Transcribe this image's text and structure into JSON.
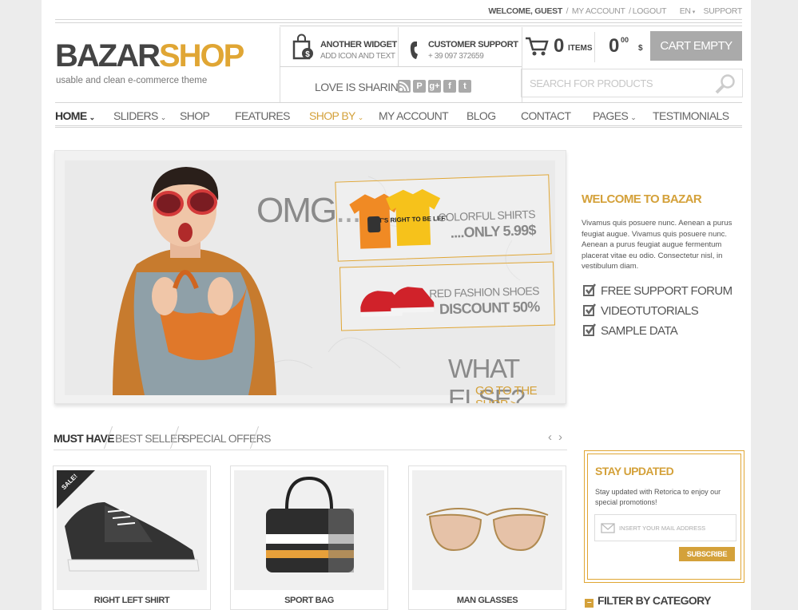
{
  "topbar": {
    "welcome": "WELCOME, GUEST",
    "my_account": "MY ACCOUNT",
    "logout": "LOGOUT",
    "lang": "EN",
    "support": "SUPPORT",
    "sep": "/"
  },
  "logo": {
    "part1": "BAZAR",
    "part2": "SHOP",
    "tagline": "usable and clean e-commerce theme"
  },
  "widgets": [
    {
      "title": "ANOTHER WIDGET",
      "subtitle": "ADD ICON AND TEXT",
      "icon": "shopping-bag-dollar-icon"
    },
    {
      "title": "CUSTOMER SUPPORT",
      "subtitle": "+ 39 097 372659",
      "icon": "phone-icon"
    }
  ],
  "sharing": {
    "label": "LOVE IS SHARING",
    "icons": [
      "rss-icon",
      "pinterest-icon",
      "google-plus-icon",
      "facebook-icon",
      "twitter-icon"
    ]
  },
  "cart": {
    "items_count": "0",
    "items_label": "ITEMS",
    "total": "0",
    "total_decimals": "00",
    "currency": "$",
    "button": "CART EMPTY"
  },
  "search": {
    "placeholder": "SEARCH FOR PRODUCTS"
  },
  "nav": [
    {
      "label": "HOME",
      "dropdown": true
    },
    {
      "label": "SLIDERS",
      "dropdown": true
    },
    {
      "label": "SHOP",
      "dropdown": false
    },
    {
      "label": "FEATURES",
      "dropdown": false
    },
    {
      "label": "SHOP BY",
      "dropdown": true
    },
    {
      "label": "MY ACCOUNT",
      "dropdown": false
    },
    {
      "label": "BLOG",
      "dropdown": false
    },
    {
      "label": "CONTACT",
      "dropdown": false
    },
    {
      "label": "PAGES",
      "dropdown": true
    },
    {
      "label": "TESTIMONIALS",
      "dropdown": false
    }
  ],
  "slider": {
    "omg": "OMG....",
    "promo1": {
      "line1": "COLORFUL SHIRTS",
      "line2": "....ONLY 5.99$",
      "shirt_text": "IT'S RIGHT TO BE LEFT"
    },
    "promo2": {
      "line1": "RED FASHION SHOES",
      "line2": "DISCOUNT 50%"
    },
    "what_else": "WHAT ELSE?",
    "go_shop": "GO TO THE SHOP >"
  },
  "welcome": {
    "title": "WELCOME TO BAZAR",
    "text": "Vivamus quis posuere nunc. Aenean a purus feugiat augue.  Vivamus quis posuere nunc. Aenean a purus feugiat augue fermentum placerat vitae eu odio. Consectetur nisl, in vestibulum diam.",
    "features": [
      "FREE SUPPORT FORUM",
      "VIDEOTUTORIALS",
      "SAMPLE DATA"
    ]
  },
  "tabs": [
    "MUST HAVE",
    "BEST SELLER",
    "SPECIAL OFFERS"
  ],
  "products": [
    {
      "name": "RIGHT LEFT SHIRT",
      "badge": "SALE!"
    },
    {
      "name": "SPORT BAG",
      "badge": ""
    },
    {
      "name": "MAN GLASSES",
      "badge": ""
    }
  ],
  "stay_updated": {
    "title": "STAY UPDATED",
    "text": "Stay updated with Retorica to enjoy our special promotions!",
    "placeholder": "INSERT YOUR MAIL ADDRESS",
    "button": "SUBSCRIBE"
  },
  "filter": {
    "title": "FILTER BY CATEGORY"
  },
  "colors": {
    "accent": "#e0a634",
    "accent_dark": "#d4a13a",
    "cart_button": "#aaaaaa"
  }
}
